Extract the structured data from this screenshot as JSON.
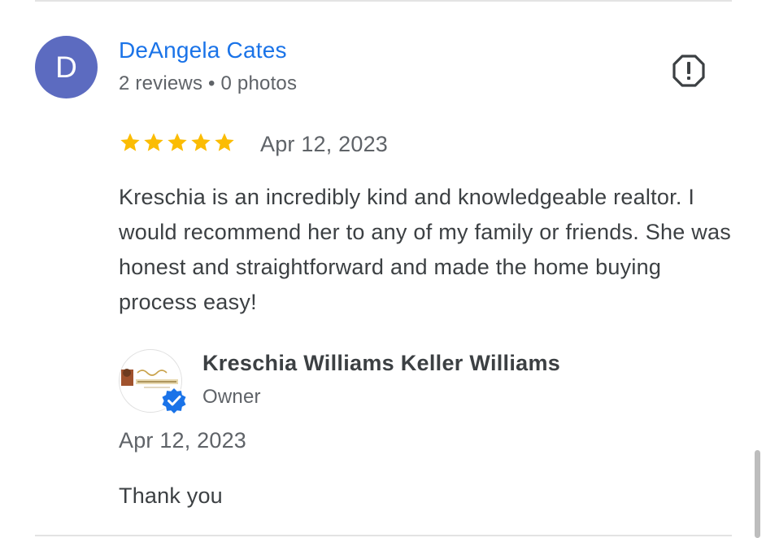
{
  "review": {
    "avatar_initial": "D",
    "reviewer_name": "DeAngela Cates",
    "reviewer_meta": "2 reviews • 0 photos",
    "rating": 5,
    "rating_max": 5,
    "date": "Apr 12, 2023",
    "text": "Kreschia is an incredibly kind and knowledgeable realtor. I would recommend her to any of my family or friends. She was honest and straightforward and made the home buying process easy!",
    "report_icon": "report-icon"
  },
  "owner_reply": {
    "name": "Kreschia Williams Keller Williams",
    "role": "Owner",
    "date": "Apr 12, 2023",
    "text": "Thank you",
    "badge_icon": "verified-badge-icon"
  },
  "colors": {
    "avatar_bg": "#5c6bc0",
    "name_link": "#1a73e8",
    "star": "#fbbc04",
    "badge": "#1a73e8"
  }
}
